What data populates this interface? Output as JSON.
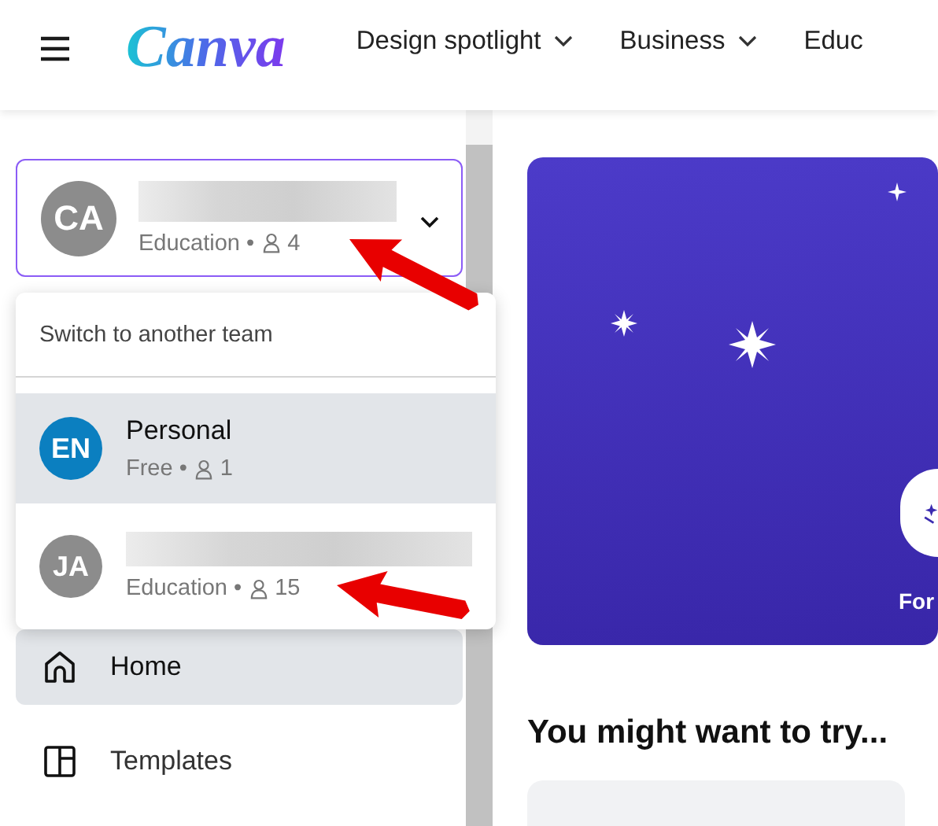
{
  "header": {
    "brand": "Canva",
    "nav": [
      {
        "label": "Design spotlight",
        "caret": true
      },
      {
        "label": "Business",
        "caret": true
      },
      {
        "label": "Educ",
        "caret": false
      }
    ]
  },
  "team": {
    "initials": "CA",
    "redacted": true,
    "plan": "Education",
    "separator": "•",
    "members": "4",
    "expanded": true
  },
  "team_menu": {
    "heading": "Switch to another team",
    "teams": [
      {
        "initials": "EN",
        "color": "#0b7fc0",
        "name": "Personal",
        "redacted": false,
        "plan": "Free",
        "separator": "•",
        "members": "1",
        "selected": true
      },
      {
        "initials": "JA",
        "color": "#8c8c8c",
        "redacted": true,
        "plan": "Education",
        "separator": "•",
        "members": "15",
        "selected": false
      }
    ]
  },
  "sidebar": {
    "items": [
      {
        "label": "Home",
        "kind": "home",
        "selected": true
      },
      {
        "label": "Templates",
        "kind": "templates",
        "selected": false
      }
    ]
  },
  "main": {
    "banner_caption": "For",
    "heading": "You might want to try..."
  }
}
